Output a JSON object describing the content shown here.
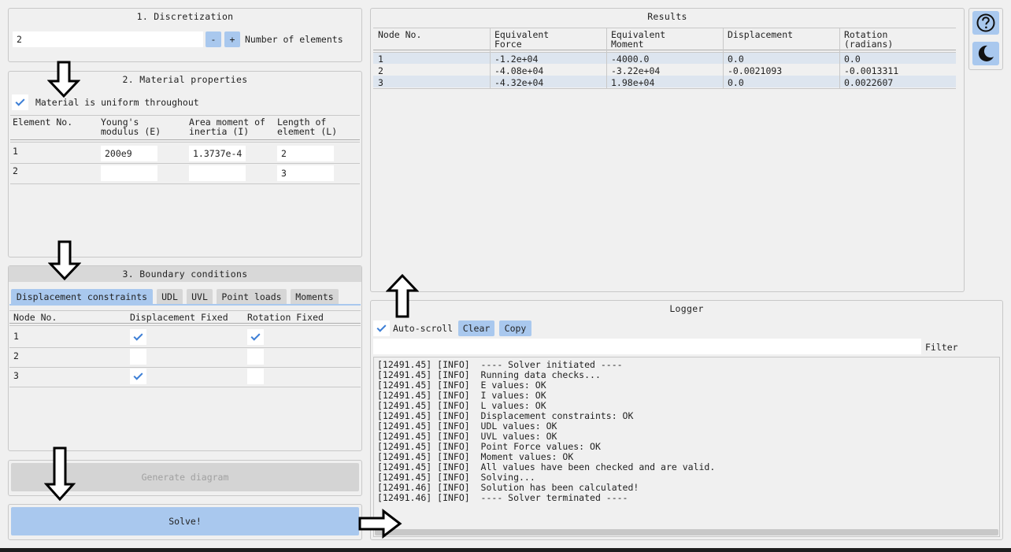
{
  "discretization": {
    "title": "1. Discretization",
    "elements_value": "2",
    "minus_label": "-",
    "plus_label": "+",
    "elements_label": "Number of elements"
  },
  "material": {
    "title": "2. Material properties",
    "uniform_label": "Material is uniform throughout",
    "uniform_checked": true,
    "headers": [
      "Element No.",
      "Young's\nmodulus (E)",
      "Area moment of\ninertia (I)",
      "Length of\nelement (L)"
    ],
    "rows": [
      {
        "no": "1",
        "E": "200e9",
        "I": "1.3737e-4",
        "L": "2"
      },
      {
        "no": "2",
        "E": "",
        "I": "",
        "L": "3"
      }
    ]
  },
  "boundary": {
    "title": "3. Boundary conditions",
    "tabs": [
      "Displacement constraints",
      "UDL",
      "UVL",
      "Point loads",
      "Moments"
    ],
    "active_tab": "Displacement constraints",
    "headers": [
      "Node No.",
      "Displacement Fixed",
      "Rotation Fixed"
    ],
    "rows": [
      {
        "node": "1",
        "disp": true,
        "rot": true
      },
      {
        "node": "2",
        "disp": false,
        "rot": false
      },
      {
        "node": "3",
        "disp": true,
        "rot": false
      }
    ]
  },
  "actions": {
    "generate_label": "Generate diagram",
    "solve_label": "Solve!"
  },
  "results": {
    "title": "Results",
    "headers": [
      "Node No.",
      "Equivalent\nForce",
      "Equivalent\nMoment",
      "Displacement",
      "Rotation\n(radians)"
    ],
    "rows": [
      [
        "1",
        "-1.2e+04",
        "-4000.0",
        "0.0",
        "0.0"
      ],
      [
        "2",
        "-4.08e+04",
        "-3.22e+04",
        "-0.0021093",
        "-0.0013311"
      ],
      [
        "3",
        "-4.32e+04",
        "1.98e+04",
        "0.0",
        "0.0022607"
      ]
    ]
  },
  "logger": {
    "title": "Logger",
    "autoscroll_label": "Auto-scroll",
    "autoscroll_checked": true,
    "clear_label": "Clear",
    "copy_label": "Copy",
    "filter_label": "Filter",
    "filter_value": "",
    "lines": [
      "[12491.45] [INFO]  ---- Solver initiated ----",
      "[12491.45] [INFO]  Running data checks...",
      "[12491.45] [INFO]  E values: OK",
      "[12491.45] [INFO]  I values: OK",
      "[12491.45] [INFO]  L values: OK",
      "[12491.45] [INFO]  Displacement constraints: OK",
      "[12491.45] [INFO]  UDL values: OK",
      "[12491.45] [INFO]  UVL values: OK",
      "[12491.45] [INFO]  Point Force values: OK",
      "[12491.45] [INFO]  Moment values: OK",
      "[12491.45] [INFO]  All values have been checked and are valid.",
      "[12491.45] [INFO]  Solving...",
      "[12491.46] [INFO]  Solution has been calculated!",
      "[12491.46] [INFO]  ---- Solver terminated ----"
    ]
  },
  "side": {
    "help_icon": "question-circle-icon",
    "theme_icon": "moon-icon"
  },
  "annotations": {
    "arrow_icon": "outline-arrow-icon"
  }
}
